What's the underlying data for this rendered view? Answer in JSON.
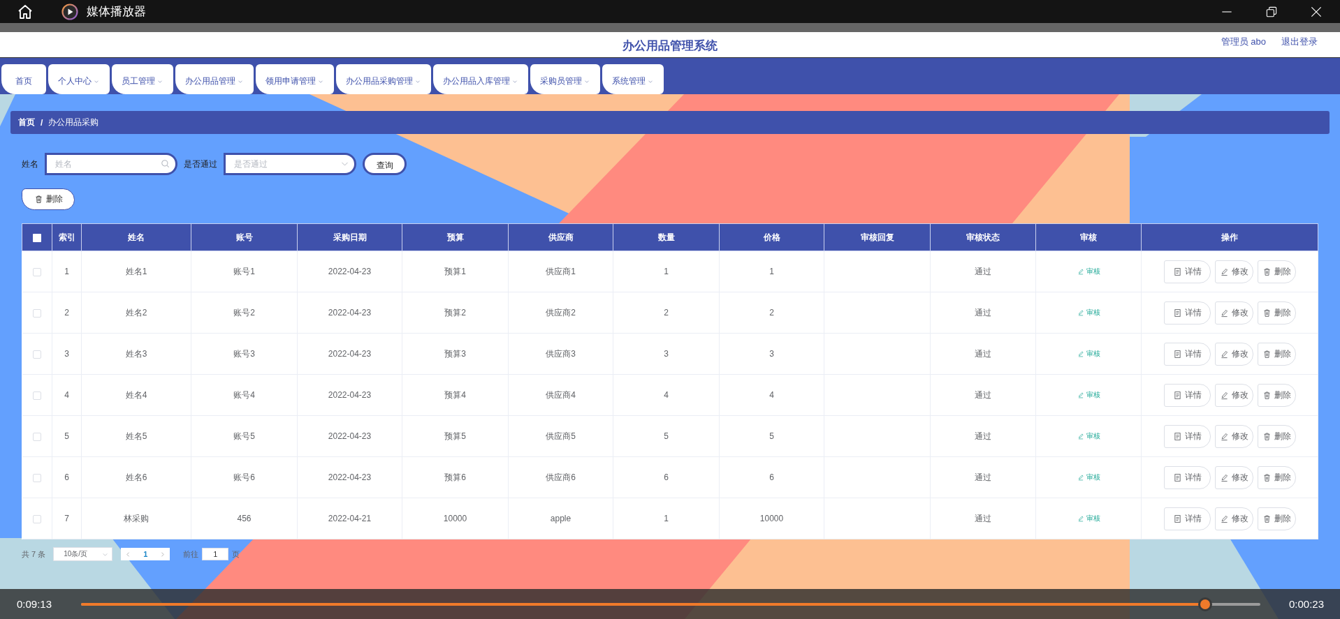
{
  "player": {
    "title": "媒体播放器",
    "elapsed": "0:09:13",
    "remaining": "0:00:23",
    "level": 0.953
  },
  "header": {
    "title": "办公用品管理系统",
    "user": "管理员 abo",
    "logout": "退出登录"
  },
  "nav": [
    {
      "label": "首页",
      "dropdown": false
    },
    {
      "label": "个人中心",
      "dropdown": true
    },
    {
      "label": "员工管理",
      "dropdown": true
    },
    {
      "label": "办公用品管理",
      "dropdown": true
    },
    {
      "label": "领用申请管理",
      "dropdown": true
    },
    {
      "label": "办公用品采购管理",
      "dropdown": true
    },
    {
      "label": "办公用品入库管理",
      "dropdown": true
    },
    {
      "label": "采购员管理",
      "dropdown": true
    },
    {
      "label": "系统管理",
      "dropdown": true
    }
  ],
  "breadcrumb": {
    "items": [
      "首页",
      "办公用品采购"
    ],
    "separator": "/"
  },
  "search": {
    "fields": [
      {
        "kind": "text",
        "label": "姓名",
        "placeholder": "姓名"
      },
      {
        "kind": "select",
        "label": "是否通过",
        "placeholder": "是否通过"
      }
    ],
    "button": "查询"
  },
  "toolbar": {
    "delete": "删除"
  },
  "table": {
    "all_checked": false,
    "columns": [
      "索引",
      "姓名",
      "账号",
      "采购日期",
      "预算",
      "供应商",
      "数量",
      "价格",
      "审核回复",
      "审核状态",
      "审核",
      "操作"
    ],
    "rows": [
      {
        "checked": false,
        "index": "1",
        "name": "姓名1",
        "account": "账号1",
        "date": "2022-04-23",
        "budget": "预算1",
        "supplier": "供应商1",
        "quantity": "1",
        "price": "1",
        "status": "通过",
        "review": "审核",
        "actions": [
          {
            "kind": "detail",
            "label": "详情"
          },
          {
            "kind": "edit",
            "label": "修改"
          },
          {
            "kind": "delete",
            "label": "删除"
          }
        ]
      },
      {
        "checked": false,
        "index": "2",
        "name": "姓名2",
        "account": "账号2",
        "date": "2022-04-23",
        "budget": "预算2",
        "supplier": "供应商2",
        "quantity": "2",
        "price": "2",
        "status": "通过",
        "review": "审核",
        "actions": [
          {
            "kind": "detail",
            "label": "详情"
          },
          {
            "kind": "edit",
            "label": "修改"
          },
          {
            "kind": "delete",
            "label": "删除"
          }
        ]
      },
      {
        "checked": false,
        "index": "3",
        "name": "姓名3",
        "account": "账号3",
        "date": "2022-04-23",
        "budget": "预算3",
        "supplier": "供应商3",
        "quantity": "3",
        "price": "3",
        "status": "通过",
        "review": "审核",
        "actions": [
          {
            "kind": "detail",
            "label": "详情"
          },
          {
            "kind": "edit",
            "label": "修改"
          },
          {
            "kind": "delete",
            "label": "删除"
          }
        ]
      },
      {
        "checked": false,
        "index": "4",
        "name": "姓名4",
        "account": "账号4",
        "date": "2022-04-23",
        "budget": "预算4",
        "supplier": "供应商4",
        "quantity": "4",
        "price": "4",
        "status": "通过",
        "review": "审核",
        "actions": [
          {
            "kind": "detail",
            "label": "详情"
          },
          {
            "kind": "edit",
            "label": "修改"
          },
          {
            "kind": "delete",
            "label": "删除"
          }
        ]
      },
      {
        "checked": false,
        "index": "5",
        "name": "姓名5",
        "account": "账号5",
        "date": "2022-04-23",
        "budget": "预算5",
        "supplier": "供应商5",
        "quantity": "5",
        "price": "5",
        "status": "通过",
        "review": "审核",
        "actions": [
          {
            "kind": "detail",
            "label": "详情"
          },
          {
            "kind": "edit",
            "label": "修改"
          },
          {
            "kind": "delete",
            "label": "删除"
          }
        ]
      },
      {
        "checked": false,
        "index": "6",
        "name": "姓名6",
        "account": "账号6",
        "date": "2022-04-23",
        "budget": "预算6",
        "supplier": "供应商6",
        "quantity": "6",
        "price": "6",
        "status": "通过",
        "review": "审核",
        "actions": [
          {
            "kind": "detail",
            "label": "详情"
          },
          {
            "kind": "edit",
            "label": "修改"
          },
          {
            "kind": "delete",
            "label": "删除"
          }
        ]
      },
      {
        "checked": false,
        "index": "7",
        "name": "林采购",
        "account": "456",
        "date": "2022-04-21",
        "budget": "10000",
        "supplier": "apple",
        "quantity": "1",
        "price": "10000",
        "status": "通过",
        "review": "审核",
        "actions": [
          {
            "kind": "detail",
            "label": "详情"
          },
          {
            "kind": "edit",
            "label": "修改"
          },
          {
            "kind": "delete",
            "label": "删除"
          }
        ]
      }
    ]
  },
  "pagination": {
    "total": "共 7 条",
    "page_size": "10条/页",
    "pages": [
      {
        "label": "1",
        "selected": true
      }
    ],
    "goto_label": "前往",
    "goto_value": "1",
    "goto_unit": "页"
  }
}
